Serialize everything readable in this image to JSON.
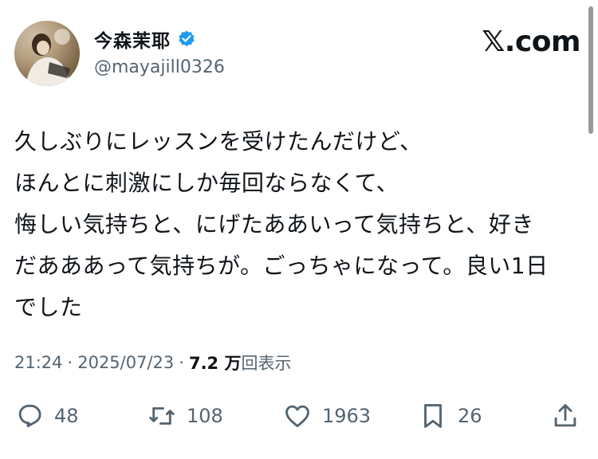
{
  "user": {
    "display_name": "今森茉耶",
    "handle": "@mayajill0326",
    "verified": true
  },
  "brand": "𝕏.com",
  "tweet": {
    "lines": [
      "久しぶりにレッスンを受けたんだけど、",
      "ほんとに刺激にしか毎回ならなくて、",
      "悔しい気持ちと、にげたああいって気持ちと、好き",
      "だあああって気持ちが。ごっちゃになって。良い1日",
      "でした"
    ]
  },
  "meta": {
    "time": "21:24",
    "separator": "·",
    "date": "2025/07/23",
    "views_count": "7.2 万",
    "views_label": "回表示"
  },
  "actions": {
    "reply_count": "48",
    "retweet_count": "108",
    "like_count": "1963",
    "bookmark_count": "26"
  },
  "colors": {
    "text": "#0f1419",
    "secondary": "#536471",
    "verified": "#1d9bf0"
  }
}
